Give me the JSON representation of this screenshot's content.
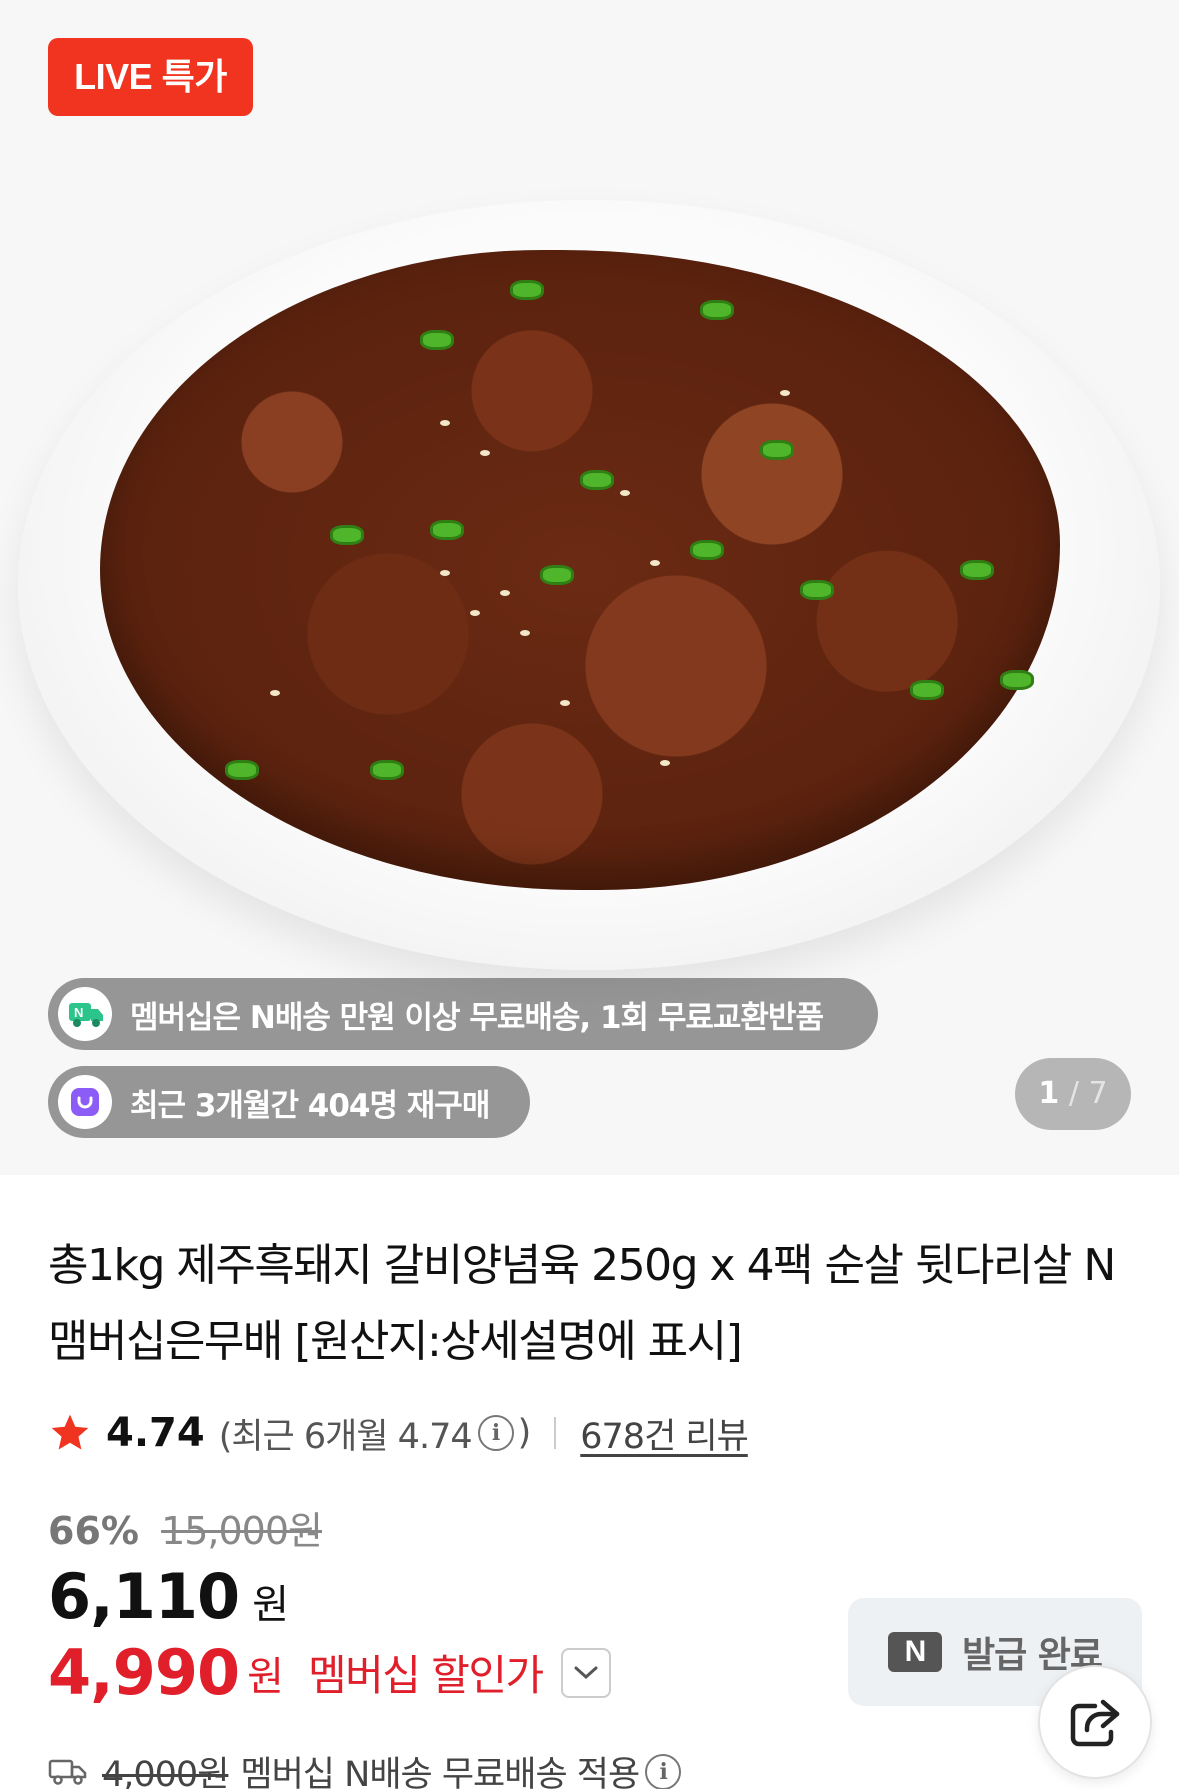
{
  "hero": {
    "live_badge": "LIVE 특가",
    "membership_chip": "멤버십은 N배송 만원 이상 무료배송, 1회 무료교환반품",
    "membership_icon": "n-delivery-truck-icon",
    "repurchase_chip": "최근 3개월간 404명 재구매",
    "repurchase_icon": "shopping-bag-icon",
    "image_counter": {
      "current": "1",
      "total": "/ 7"
    }
  },
  "product": {
    "title": "총1kg 제주흑돼지 갈비양념육 250g x 4팩 순살 뒷다리살 N맴버십은무배 [원산지:상세설명에 표시]",
    "rating": "4.74",
    "recent_rating_prefix": "(최근 6개월 4.74",
    "recent_rating_suffix": ")",
    "reviews": "678건 리뷰",
    "discount_percent": "66%",
    "original_price": "15,000원",
    "sale_price": "6,110",
    "sale_unit": "원",
    "member_price": "4,990",
    "member_unit": "원",
    "member_label": "멤버십 할인가",
    "coupon_logo": "N",
    "coupon_label": "발급 완료",
    "shipping_old": "4,000원",
    "shipping_text": "멤버십 N배송 무료배송 적용"
  },
  "colors": {
    "live_red": "#f0341f",
    "member_red": "#e01f2b",
    "star": "#f0341f"
  }
}
